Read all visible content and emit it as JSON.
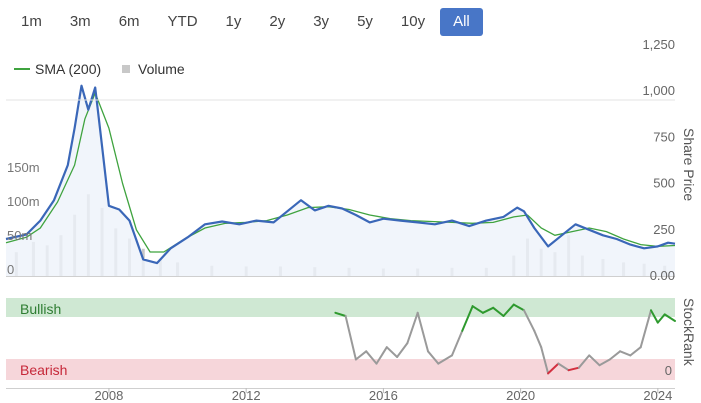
{
  "range_buttons": [
    {
      "label": "1m",
      "active": false
    },
    {
      "label": "3m",
      "active": false
    },
    {
      "label": "6m",
      "active": false
    },
    {
      "label": "YTD",
      "active": false
    },
    {
      "label": "1y",
      "active": false
    },
    {
      "label": "2y",
      "active": false
    },
    {
      "label": "3y",
      "active": false
    },
    {
      "label": "5y",
      "active": false
    },
    {
      "label": "10y",
      "active": false
    },
    {
      "label": "All",
      "active": true
    }
  ],
  "colors": {
    "price": "#3a67b8",
    "sma": "#3fa33f",
    "volume": "#c8c8c8",
    "bullish_band": "#cfe8d3",
    "bearish_band": "#f6d6da",
    "bullish_text": "#2e7d32",
    "bearish_text": "#c62839",
    "rank_line": "#9a9a9a",
    "rank_bull": "#2e9a2e",
    "rank_bear": "#d32f3f",
    "accent": "#4876c7"
  },
  "chart_data": [
    {
      "type": "line",
      "title": "",
      "ylabel": "Share Price",
      "xlim": [
        2005.0,
        2024.5
      ],
      "ylim": [
        0,
        1250
      ],
      "y_ticks": [
        "0.00",
        "250",
        "500",
        "750",
        "1,000",
        "1,250"
      ],
      "y_tick_values": [
        0,
        250,
        500,
        750,
        1000,
        1250
      ],
      "x_ticks": [
        "2008",
        "2012",
        "2016",
        "2020",
        "2024"
      ],
      "x_tick_values": [
        2008,
        2012,
        2016,
        2020,
        2024
      ],
      "legend": [
        "SMA (200)",
        "Volume"
      ],
      "grid": false,
      "series": [
        {
          "name": "Share price",
          "x": [
            2005.0,
            2005.6,
            2006.0,
            2006.4,
            2006.8,
            2007.0,
            2007.2,
            2007.4,
            2007.6,
            2007.8,
            2008.0,
            2008.3,
            2008.6,
            2009.0,
            2009.4,
            2009.8,
            2010.3,
            2010.8,
            2011.3,
            2011.8,
            2012.3,
            2012.8,
            2013.2,
            2013.6,
            2014.0,
            2014.4,
            2014.8,
            2015.2,
            2015.6,
            2016.0,
            2016.5,
            2017.0,
            2017.5,
            2018.0,
            2018.5,
            2019.0,
            2019.5,
            2019.9,
            2020.1,
            2020.4,
            2020.8,
            2021.2,
            2021.6,
            2022.0,
            2022.4,
            2022.8,
            2023.2,
            2023.6,
            2024.0,
            2024.3,
            2024.5
          ],
          "values": [
            200,
            225,
            300,
            410,
            600,
            800,
            1030,
            900,
            1020,
            700,
            380,
            360,
            300,
            90,
            70,
            150,
            210,
            280,
            295,
            280,
            300,
            290,
            350,
            410,
            355,
            380,
            365,
            330,
            290,
            310,
            300,
            290,
            280,
            300,
            270,
            300,
            320,
            370,
            350,
            260,
            160,
            220,
            280,
            250,
            220,
            200,
            170,
            150,
            160,
            180,
            175
          ]
        },
        {
          "name": "SMA (200)",
          "x": [
            2005.0,
            2005.6,
            2006.0,
            2006.5,
            2007.0,
            2007.3,
            2007.6,
            2008.0,
            2008.4,
            2008.8,
            2009.2,
            2009.6,
            2010.2,
            2010.8,
            2011.4,
            2012.0,
            2012.6,
            2013.2,
            2013.8,
            2014.4,
            2015.0,
            2015.6,
            2016.2,
            2016.8,
            2017.4,
            2018.0,
            2018.6,
            2019.2,
            2019.8,
            2020.2,
            2020.6,
            2021.0,
            2021.5,
            2022.0,
            2022.5,
            2023.0,
            2023.5,
            2024.0,
            2024.5
          ],
          "values": [
            180,
            210,
            260,
            400,
            600,
            850,
            990,
            800,
            500,
            250,
            130,
            130,
            200,
            260,
            285,
            290,
            300,
            330,
            370,
            375,
            360,
            330,
            310,
            300,
            295,
            290,
            285,
            290,
            320,
            330,
            260,
            220,
            240,
            260,
            240,
            200,
            170,
            160,
            165
          ]
        }
      ]
    },
    {
      "type": "bar",
      "title": "Volume",
      "y_ticks": [
        "0",
        "50m",
        "100m",
        "150m"
      ],
      "y_tick_values": [
        0,
        50,
        100,
        150
      ],
      "ylim": [
        0,
        185
      ],
      "x": [
        2005.3,
        2005.8,
        2006.2,
        2006.6,
        2007.0,
        2007.4,
        2007.8,
        2008.2,
        2008.6,
        2009.0,
        2009.5,
        2010.0,
        2011.0,
        2012.0,
        2013.0,
        2014.0,
        2015.0,
        2016.0,
        2017.0,
        2018.0,
        2019.0,
        2019.8,
        2020.2,
        2020.6,
        2021.0,
        2021.4,
        2021.8,
        2022.4,
        2023.0,
        2023.6,
        2024.2
      ],
      "values": [
        35,
        50,
        45,
        60,
        90,
        120,
        100,
        70,
        55,
        40,
        25,
        20,
        15,
        14,
        14,
        13,
        12,
        11,
        11,
        12,
        12,
        30,
        55,
        40,
        35,
        60,
        30,
        25,
        20,
        18,
        15
      ]
    },
    {
      "type": "line",
      "title": "StockRank",
      "ylim": [
        0,
        100
      ],
      "y_ticks": [
        "0"
      ],
      "y_tick_values": [
        0
      ],
      "bands": [
        "Bullish",
        "Bearish"
      ],
      "series": [
        {
          "name": "StockRank",
          "x": [
            2014.6,
            2014.9,
            2015.2,
            2015.5,
            2015.8,
            2016.1,
            2016.4,
            2016.7,
            2017.0,
            2017.3,
            2017.6,
            2018.0,
            2018.3,
            2018.6,
            2018.9,
            2019.2,
            2019.5,
            2019.8,
            2020.1,
            2020.4,
            2020.6,
            2020.8,
            2021.1,
            2021.4,
            2021.7,
            2022.0,
            2022.3,
            2022.6,
            2022.9,
            2023.2,
            2023.5,
            2023.8,
            2024.0,
            2024.2,
            2024.5
          ],
          "values": [
            82,
            78,
            25,
            35,
            20,
            40,
            28,
            45,
            82,
            35,
            20,
            30,
            60,
            90,
            82,
            88,
            78,
            92,
            85,
            60,
            40,
            8,
            20,
            12,
            15,
            30,
            18,
            25,
            35,
            30,
            40,
            85,
            70,
            80,
            72
          ]
        }
      ]
    }
  ]
}
